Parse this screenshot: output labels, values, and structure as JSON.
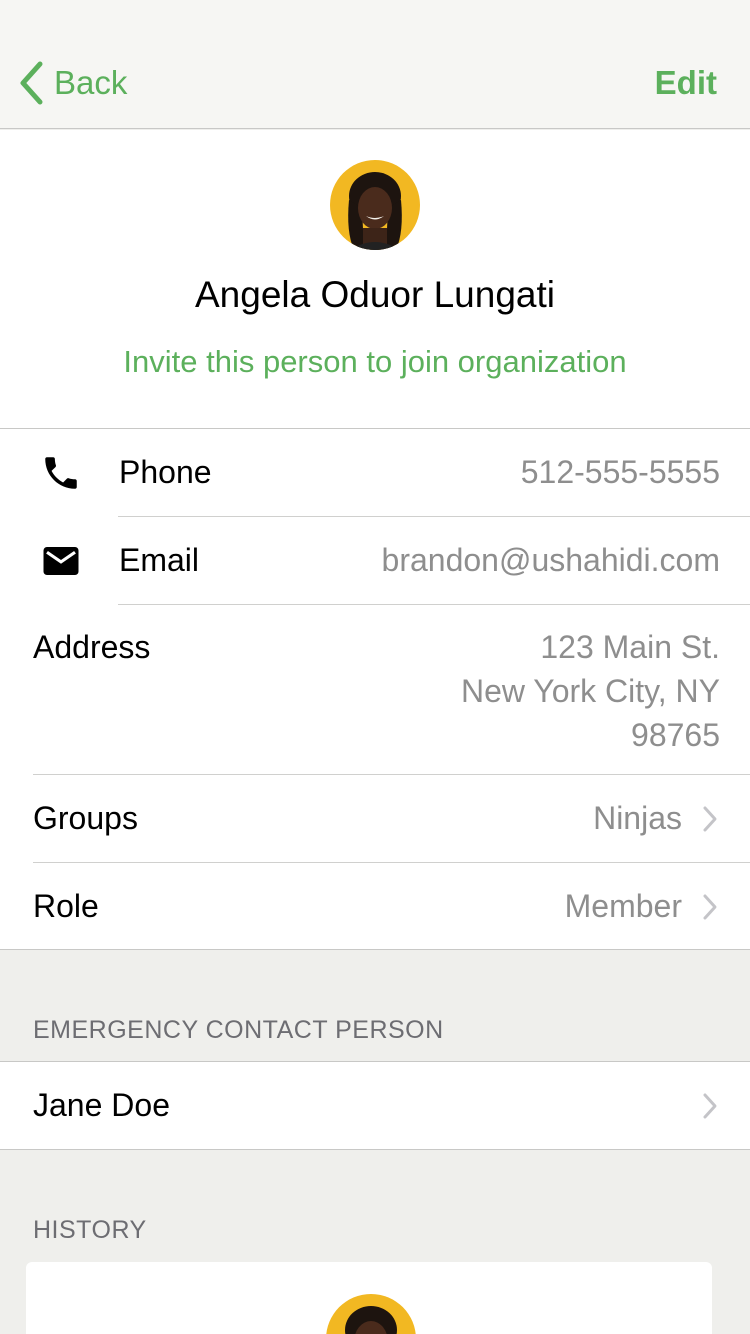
{
  "nav": {
    "back_label": "Back",
    "edit_label": "Edit"
  },
  "profile": {
    "name": "Angela Oduor Lungati",
    "invite_label": "Invite this person to join organization"
  },
  "details": {
    "phone": {
      "label": "Phone",
      "value": "512-555-5555"
    },
    "email": {
      "label": "Email",
      "value": "brandon@ushahidi.com"
    },
    "address": {
      "label": "Address",
      "line1": "123 Main St.",
      "line2": "New York City, NY",
      "line3": "98765"
    },
    "groups": {
      "label": "Groups",
      "value": "Ninjas"
    },
    "role": {
      "label": "Role",
      "value": "Member"
    }
  },
  "emergency": {
    "header": "EMERGENCY CONTACT PERSON",
    "name": "Jane Doe"
  },
  "history": {
    "header": "HISTORY"
  },
  "colors": {
    "accent": "#5cb05c",
    "secondary_text": "#8e8e8e",
    "background": "#efefec"
  }
}
